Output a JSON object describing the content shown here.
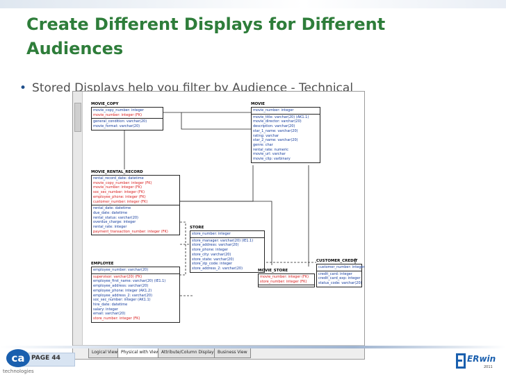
{
  "slide": {
    "title_line1": "Create Different Displays for Different",
    "title_line2": "Audiences",
    "bullet": "Stored Displays help you filter by Audience - Technical",
    "page_label": "PAGE 44",
    "brand_logo": "ca",
    "brand_subtitle": "technologies",
    "erwin_logo": "ERwin",
    "erwin_year": "2011",
    "colors": {
      "title": "#2e7d3a",
      "pk_attr": "#123a9c",
      "fk_attr": "#d81818"
    }
  },
  "diagram": {
    "tabs": [
      {
        "label": "Logical View",
        "active": false
      },
      {
        "label": "Physical with Views",
        "active": true
      },
      {
        "label": "Attribute/Column Display",
        "active": false
      },
      {
        "label": "Business View",
        "active": false
      }
    ],
    "entities": {
      "movie_copy": {
        "name": "MOVIE_COPY",
        "keys": [
          {
            "text": "movie_copy_number: integer",
            "fk": false
          },
          {
            "text": "movie_number: integer (FK)",
            "fk": true
          }
        ],
        "attrs": [
          {
            "text": "general_condition: varchar(20)",
            "fk": false
          },
          {
            "text": "movie_format: varchar(20)",
            "fk": false
          }
        ]
      },
      "movie": {
        "name": "MOVIE",
        "keys": [
          {
            "text": "movie_number: integer",
            "fk": false
          }
        ],
        "attrs": [
          {
            "text": "movie_title: varchar(20) (AK1.1)",
            "fk": false
          },
          {
            "text": "movie_director: varchar(20)",
            "fk": false
          },
          {
            "text": "description: varchar(20)",
            "fk": false
          },
          {
            "text": "star_1_name: varchar(20)",
            "fk": false
          },
          {
            "text": "rating: varchar",
            "fk": false
          },
          {
            "text": "star_2_name: varchar(20)",
            "fk": false
          },
          {
            "text": "genre: char",
            "fk": false
          },
          {
            "text": "rental_rate: numeric",
            "fk": false
          },
          {
            "text": "movie_url: varchar",
            "fk": false
          },
          {
            "text": "movie_clip: varbinary",
            "fk": false
          }
        ]
      },
      "movie_rental_record": {
        "name": "MOVIE_RENTAL_RECORD",
        "keys": [
          {
            "text": "rental_record_date: datetime",
            "fk": false
          },
          {
            "text": "movie_copy_number: integer (FK)",
            "fk": true
          },
          {
            "text": "movie_number: integer (FK)",
            "fk": true
          },
          {
            "text": "soc_sec_number: integer (FK)",
            "fk": true
          },
          {
            "text": "employee_phone: integer (FK)",
            "fk": true
          },
          {
            "text": "customer_number: integer (FK)",
            "fk": true
          }
        ],
        "attrs": [
          {
            "text": "rental_date: datetime",
            "fk": false
          },
          {
            "text": "due_date: datetime",
            "fk": false
          },
          {
            "text": "rental_status: varchar(20)",
            "fk": false
          },
          {
            "text": "overdue_charge: integer",
            "fk": false
          },
          {
            "text": "rental_rate: integer",
            "fk": false
          },
          {
            "text": "payment_transaction_number: integer (FK)",
            "fk": true
          }
        ]
      },
      "store": {
        "name": "STORE",
        "keys": [
          {
            "text": "store_number: integer",
            "fk": false
          }
        ],
        "attrs": [
          {
            "text": "store_manager: varchar(20) (IE1.1)",
            "fk": false
          },
          {
            "text": "store_address: varchar(20)",
            "fk": false
          },
          {
            "text": "store_phone: integer",
            "fk": false
          },
          {
            "text": "store_city: varchar(20)",
            "fk": false
          },
          {
            "text": "store_state: varchar(20)",
            "fk": false
          },
          {
            "text": "store_zip_code: integer",
            "fk": false
          },
          {
            "text": "store_address_2: varchar(20)",
            "fk": false
          }
        ]
      },
      "employee": {
        "name": "EMPLOYEE",
        "keys": [
          {
            "text": "employee_number: varchar(20)",
            "fk": false
          }
        ],
        "attrs": [
          {
            "text": "supervisor: varchar(20) (FK)",
            "fk": true
          },
          {
            "text": "employee_first_name: varchar(20) (IE1.1)",
            "fk": false
          },
          {
            "text": "employee_address: varchar(20)",
            "fk": false
          },
          {
            "text": "employee_phone: integer (AK1.2)",
            "fk": false
          },
          {
            "text": "employee_address_2: varchar(20)",
            "fk": false
          },
          {
            "text": "soc_sec_number: integer (AK1.1)",
            "fk": false
          },
          {
            "text": "hire_date: datetime",
            "fk": false
          },
          {
            "text": "salary: integer",
            "fk": false
          },
          {
            "text": "email: varchar(20)",
            "fk": false
          },
          {
            "text": "store_number: integer (FK)",
            "fk": true
          }
        ]
      },
      "movie_store": {
        "name": "MOVIE_STORE",
        "keys": [
          {
            "text": "movie_number: integer (FK)",
            "fk": true
          },
          {
            "text": "store_number: integer (FK)",
            "fk": true
          }
        ],
        "attrs": []
      },
      "customer_credit": {
        "name": "CUSTOMER_CREDIT",
        "keys": [
          {
            "text": "customer_number: integer",
            "fk": false
          }
        ],
        "attrs": [
          {
            "text": "credit_card: integer",
            "fk": false
          },
          {
            "text": "credit_card_exp: integer",
            "fk": false
          },
          {
            "text": "status_code: varchar(20)",
            "fk": false
          }
        ]
      }
    }
  }
}
